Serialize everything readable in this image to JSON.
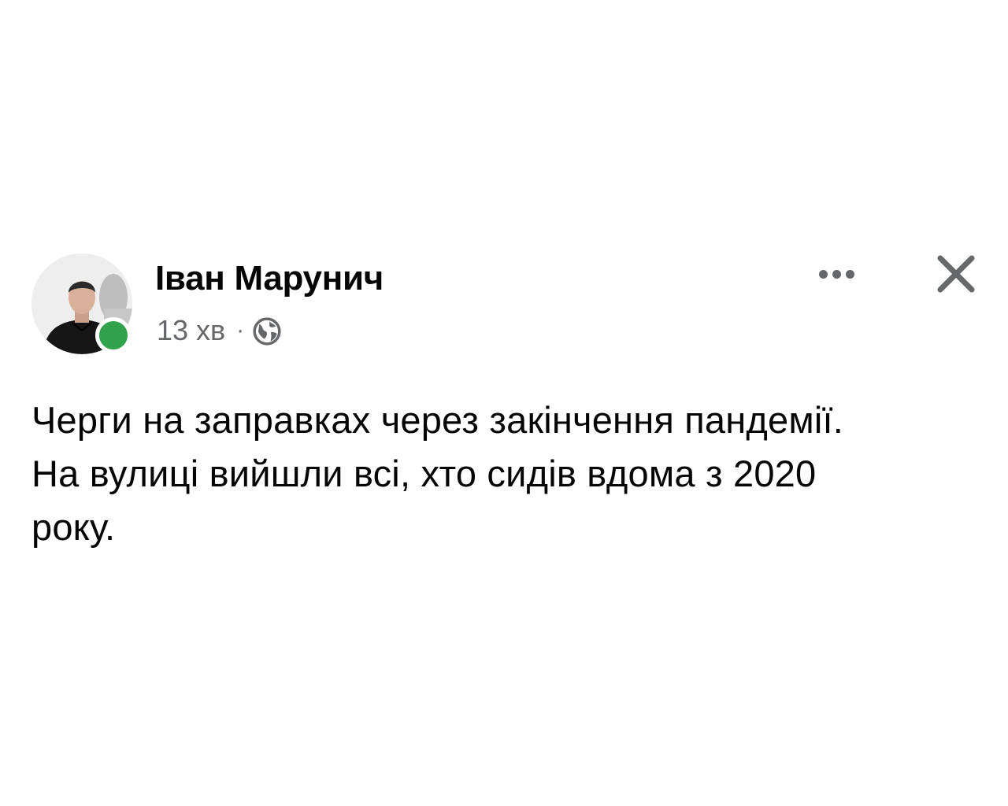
{
  "post": {
    "author": {
      "name": "Іван Марунич",
      "online_status": "online",
      "online_color": "#31a24c"
    },
    "timestamp": "13 хв",
    "separator": "·",
    "audience_icon": "globe-icon",
    "actions": {
      "more_icon": "more-horizontal-icon",
      "close_icon": "close-icon"
    },
    "text_lines": [
      "Черги на заправках через закінчення пандемії.",
      "На вулиці вийшли всі, хто сидів вдома з 2020",
      "року."
    ]
  },
  "colors": {
    "text": "#050505",
    "secondary_text": "#65676b",
    "background": "#ffffff"
  }
}
